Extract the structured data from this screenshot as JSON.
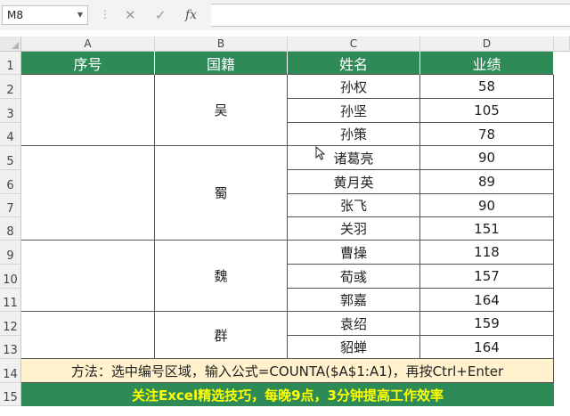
{
  "formula_bar": {
    "name_box": "M8",
    "cancel_icon": "✕",
    "enter_icon": "✓",
    "fx_label": "fx",
    "formula": ""
  },
  "columns": [
    "A",
    "B",
    "C",
    "D"
  ],
  "rows": [
    "1",
    "2",
    "3",
    "4",
    "5",
    "6",
    "7",
    "8",
    "9",
    "10",
    "11",
    "12",
    "13",
    "14",
    "15"
  ],
  "header": {
    "seq": "序号",
    "country": "国籍",
    "name": "姓名",
    "score": "业绩"
  },
  "groups": [
    {
      "country": "吴",
      "seq": "",
      "members": [
        {
          "name": "孙权",
          "score": "58"
        },
        {
          "name": "孙坚",
          "score": "105"
        },
        {
          "name": "孙策",
          "score": "78"
        }
      ]
    },
    {
      "country": "蜀",
      "seq": "",
      "members": [
        {
          "name": "诸葛亮",
          "score": "90"
        },
        {
          "name": "黄月英",
          "score": "89"
        },
        {
          "name": "张飞",
          "score": "90"
        },
        {
          "name": "关羽",
          "score": "151"
        }
      ]
    },
    {
      "country": "魏",
      "seq": "",
      "members": [
        {
          "name": "曹操",
          "score": "118"
        },
        {
          "name": "荀彧",
          "score": "157"
        },
        {
          "name": "郭嘉",
          "score": "164"
        }
      ]
    },
    {
      "country": "群",
      "seq": "",
      "members": [
        {
          "name": "袁绍",
          "score": "159"
        },
        {
          "name": "貂蝉",
          "score": "164"
        }
      ]
    }
  ],
  "note": "方法：选中编号区域，输入公式=COUNTA($A$1:A1)，再按Ctrl+Enter",
  "promo": "关注Excel精选技巧，每晚9点，3分钟提高工作效率",
  "colors": {
    "header_green": "#2e8b57",
    "note_bg": "#fff2cc",
    "promo_text": "#ffff00"
  }
}
